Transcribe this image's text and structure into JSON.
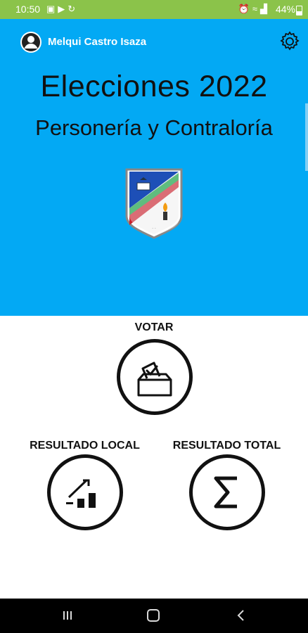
{
  "status_bar": {
    "time": "10:50",
    "battery": "44%",
    "left_icons": [
      "image-icon",
      "youtube-icon",
      "sync-icon"
    ],
    "right_icons": [
      "alarm-icon",
      "wifi-icon",
      "signal-icon",
      "battery-icon"
    ]
  },
  "header": {
    "user_name": "Melqui Castro Isaza",
    "title": "Elecciones 2022",
    "subtitle": "Personería y Contraloría",
    "colors": {
      "accent": "#03a9f4",
      "status_bar": "#8bc34a"
    }
  },
  "actions": {
    "vote_label": "VOTAR",
    "local_results_label": "RESULTADO LOCAL",
    "total_results_label": "RESULTADO TOTAL"
  }
}
